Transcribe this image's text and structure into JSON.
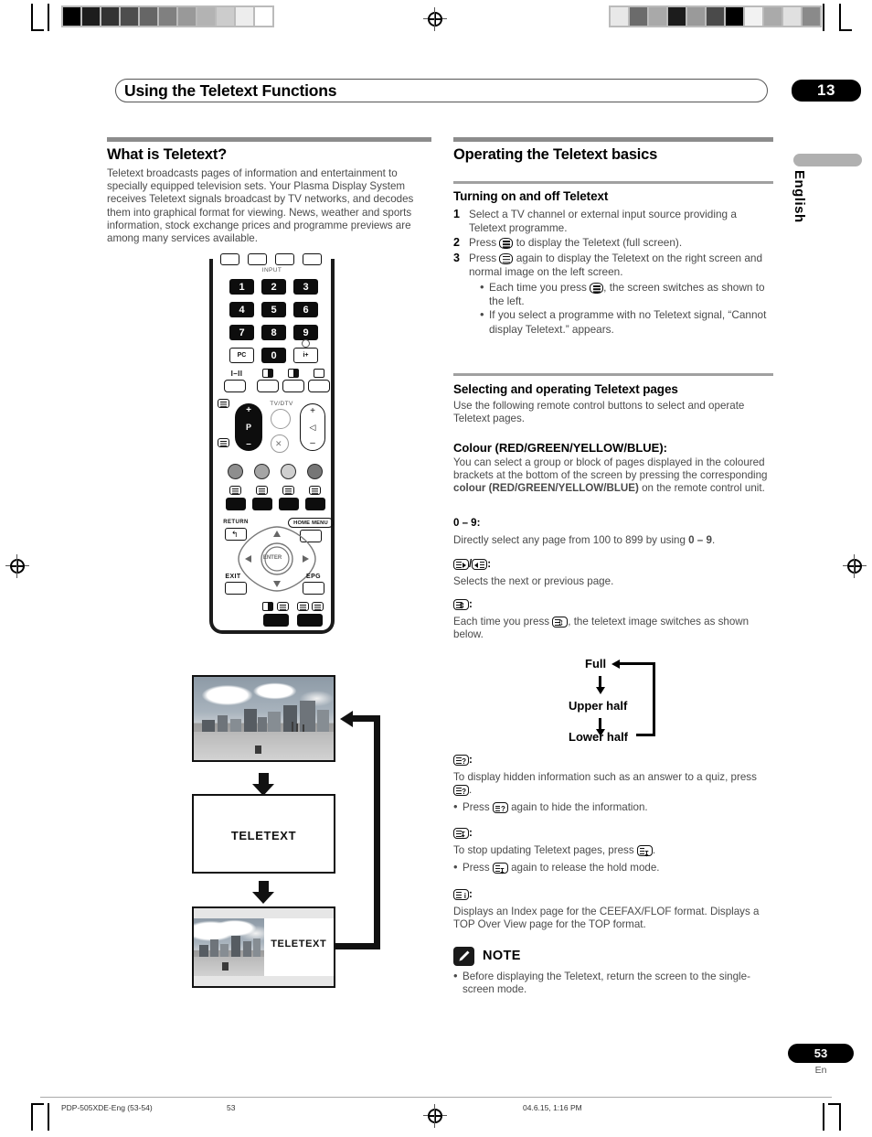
{
  "page": {
    "chapter_number": "13",
    "title": "Using the Teletext Functions",
    "language_tab": "English",
    "page_number": "53",
    "page_locale": "En"
  },
  "footer": {
    "file": "PDP-505XDE-Eng (53-54)",
    "page": "53",
    "timestamp": "04.6.15, 1:16 PM"
  },
  "left_column": {
    "heading": "What is Teletext?",
    "body": "Teletext broadcasts pages of information and entertainment to specially equipped television sets. Your Plasma Display System receives Teletext signals broadcast by TV networks, and decodes them into graphical format for viewing. News, weather and sports information, stock exchange prices and programme previews are among many services available."
  },
  "remote": {
    "input_label": "INPUT",
    "numbers": [
      "1",
      "2",
      "3",
      "4",
      "5",
      "6",
      "7",
      "8",
      "9"
    ],
    "pc_label": "PC",
    "zero_label": "0",
    "info_label": "i+",
    "sound_label": "I–II",
    "tvdtv_label": "TV/DTV",
    "p_label": "P",
    "plus": "+",
    "minus": "–",
    "return_label": "RETURN",
    "home_menu_label": "HOME MENU",
    "enter_label": "ENTER",
    "exit_label": "EXIT",
    "epg_label": "EPG"
  },
  "screen_flow": {
    "teletext_label": "TELETEXT",
    "split_label": "TELETEXT"
  },
  "right_column": {
    "heading": "Operating the Teletext basics",
    "turning": {
      "heading": "Turning on and off Teletext",
      "steps": [
        {
          "n": "1",
          "text": "Select a TV channel or external input source providing a Teletext programme.",
          "bullets": []
        },
        {
          "n": "2",
          "pre": "Press ",
          "post": " to display the Teletext (full screen).",
          "bullets": []
        },
        {
          "n": "3",
          "pre": "Press ",
          "post": " again to display the Teletext on the right screen and normal image on the left screen.",
          "bullets": [
            {
              "pre": "Each time you press ",
              "post": ", the screen switches as shown to the left."
            },
            {
              "pre": "If you select a programme with no Teletext signal, “Cannot display Teletext.” appears.",
              "post": ""
            }
          ]
        }
      ]
    },
    "selecting": {
      "heading": "Selecting and operating Teletext pages",
      "intro": "Use the following remote control buttons to select and operate Teletext pages.",
      "entries": [
        {
          "key": "Colour (RED/GREEN/YELLOW/BLUE):",
          "body_1": "You can select a group or block of pages displayed in the coloured brackets at the bottom of the screen by pressing the corresponding ",
          "body_bold": "colour (RED/GREEN/YELLOW/BLUE)",
          "body_2": " on the remote control unit."
        },
        {
          "key": "0 – 9:",
          "body_1": "Directly select any page from 100 to 899 by using ",
          "body_bold": "0 – 9",
          "body_2": "."
        },
        {
          "key_icons": "page-next-icon / page-prev-icon",
          "body": "Selects the next or previous page."
        },
        {
          "key_icons": "size-icon",
          "body_1": "Each time you press ",
          "body_2": ", the teletext image switches as shown below."
        },
        {
          "key_icons": "reveal-icon",
          "body_1": "To display hidden information such as an answer to a quiz, press ",
          "body_2": ".",
          "bullet_1": "Press ",
          "bullet_2": " again to hide the information."
        },
        {
          "key_icons": "hold-icon",
          "body_1": "To stop updating Teletext pages, press ",
          "body_2": ".",
          "bullet_1": "Press ",
          "bullet_2": " again to release the hold mode."
        },
        {
          "key_icons": "index-icon",
          "body": "Displays an Index page for the CEEFAX/FLOF format. Displays a TOP Over View page for the TOP format."
        }
      ]
    },
    "size_flow": {
      "full": "Full",
      "upper": "Upper half",
      "lower": "Lower half"
    },
    "note": {
      "title": "NOTE",
      "items": [
        "Before displaying the Teletext, return the screen to the single-screen mode."
      ]
    }
  },
  "colors": {
    "heading_rule": "#8c8c8c",
    "body_text": "#4a4a4a",
    "badge_bg": "#000000",
    "lang_tab": "#b0b0b0"
  }
}
